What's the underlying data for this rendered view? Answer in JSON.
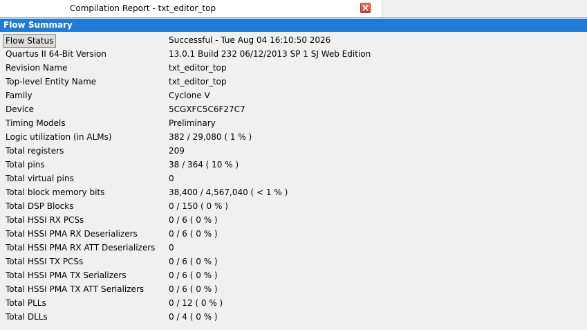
{
  "tab": {
    "title": "Compilation Report - txt_editor_top"
  },
  "header": {
    "title": "Flow Summary"
  },
  "rows": [
    {
      "key": "Flow Status",
      "value": "Successful - Tue Aug 04 16:10:50 2026"
    },
    {
      "key": "Quartus II 64-Bit Version",
      "value": "13.0.1 Build 232 06/12/2013 SP 1 SJ Web Edition"
    },
    {
      "key": "Revision Name",
      "value": "txt_editor_top"
    },
    {
      "key": "Top-level Entity Name",
      "value": "txt_editor_top"
    },
    {
      "key": "Family",
      "value": "Cyclone V"
    },
    {
      "key": "Device",
      "value": "5CGXFC5C6F27C7"
    },
    {
      "key": "Timing Models",
      "value": "Preliminary"
    },
    {
      "key": "Logic utilization (in ALMs)",
      "value": "382 / 29,080 ( 1 % )"
    },
    {
      "key": "Total registers",
      "value": "209"
    },
    {
      "key": "Total pins",
      "value": "38 / 364 ( 10 % )"
    },
    {
      "key": "Total virtual pins",
      "value": "0"
    },
    {
      "key": "Total block memory bits",
      "value": "38,400 / 4,567,040 ( < 1 % )"
    },
    {
      "key": "Total DSP Blocks",
      "value": "0 / 150 ( 0 % )"
    },
    {
      "key": "Total HSSI RX PCSs",
      "value": "0 / 6 ( 0 % )"
    },
    {
      "key": "Total HSSI PMA RX Deserializers",
      "value": "0 / 6 ( 0 % )"
    },
    {
      "key": "Total HSSI PMA RX ATT Deserializers",
      "value": "0"
    },
    {
      "key": "Total HSSI TX PCSs",
      "value": "0 / 6 ( 0 % )"
    },
    {
      "key": "Total HSSI PMA TX Serializers",
      "value": "0 / 6 ( 0 % )"
    },
    {
      "key": "Total HSSI PMA TX ATT Serializers",
      "value": "0 / 6 ( 0 % )"
    },
    {
      "key": "Total PLLs",
      "value": "0 / 12 ( 0 % )"
    },
    {
      "key": "Total DLLs",
      "value": "0 / 4 ( 0 % )"
    }
  ]
}
